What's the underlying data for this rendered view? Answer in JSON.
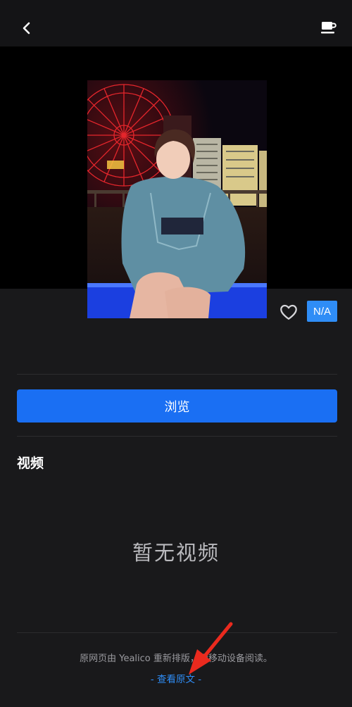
{
  "header": {
    "back_icon": "chevron-left-icon",
    "coffee_icon": "coffee-cup-icon"
  },
  "actions": {
    "favorite_icon": "heart-outline-icon",
    "badge": "N/A",
    "badge_color": "#2f8df6"
  },
  "browse_button": {
    "label": "浏览",
    "color": "#1a6ff3"
  },
  "video_section": {
    "title": "视频",
    "empty_message": "暂无视频"
  },
  "footer": {
    "note": "原网页由 Yealico 重新排版，便移动设备阅读。",
    "link": "- 查看原文 -"
  },
  "annotation": {
    "arrow_color": "#ea2a1e"
  }
}
